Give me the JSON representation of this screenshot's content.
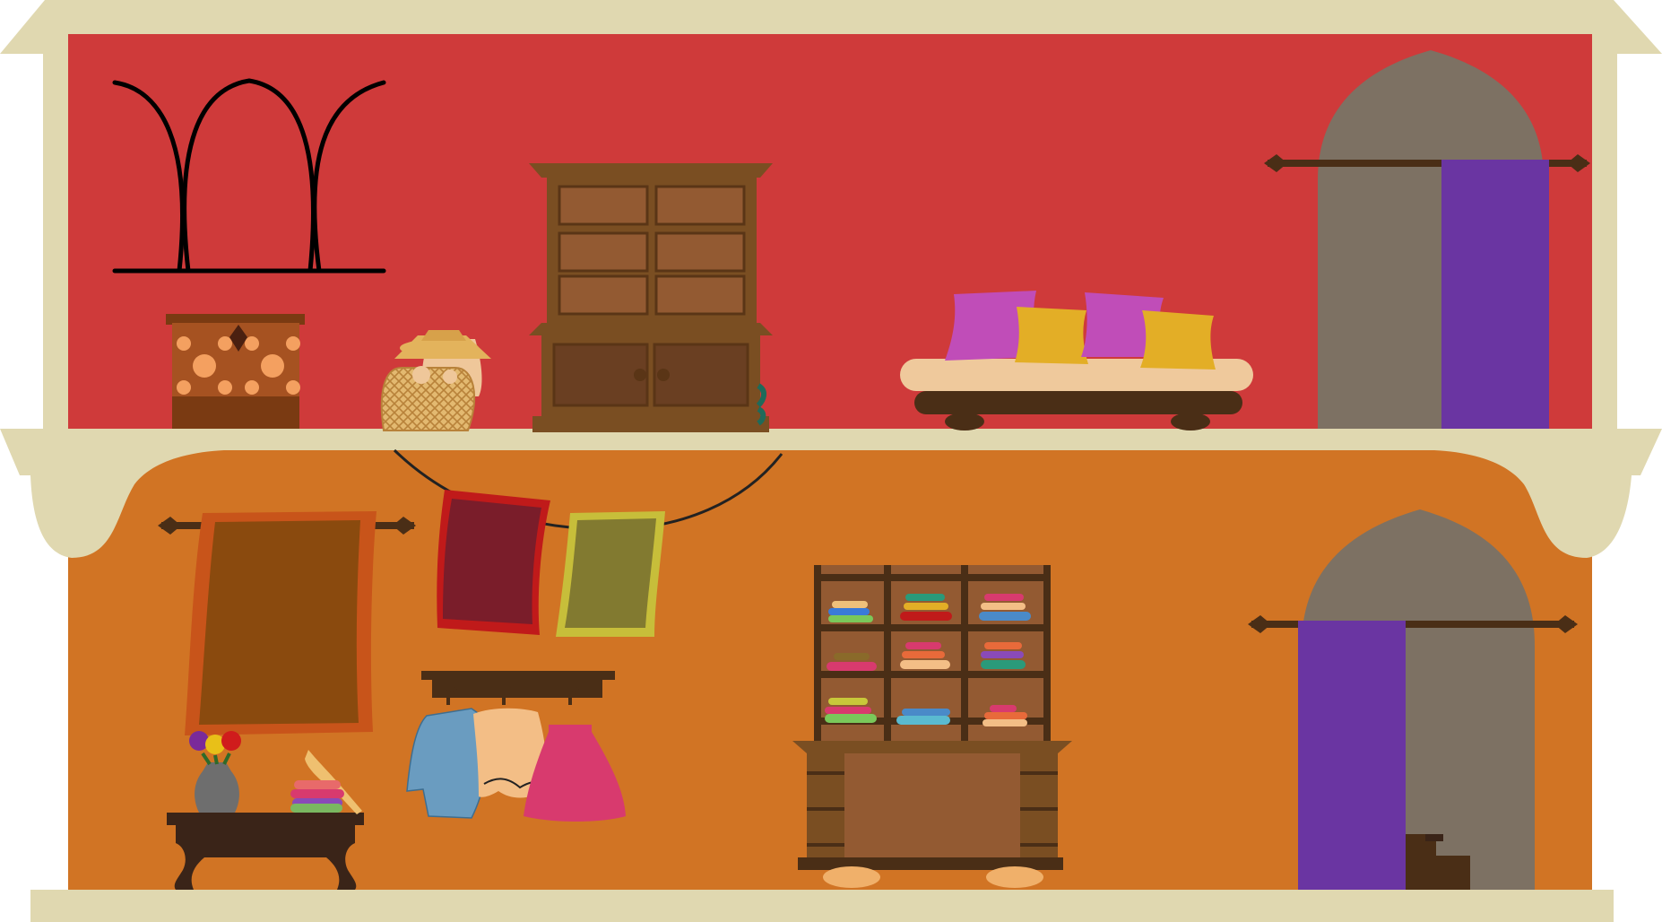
{
  "scene": {
    "kind": "two-storey house cross-section",
    "colors": {
      "upper_wall": "#CF3A3A",
      "lower_wall": "#D17424",
      "trim": "#E0D8B0",
      "wood_dark": "#4A2E16",
      "wood_mid": "#7A4E22",
      "wood_light": "#935A32",
      "curtain_purple": "#6A35A2",
      "archway_gray": "#7D7163",
      "rug_brown": "#8A4A0E",
      "towel_maroon": "#7A1D2A",
      "towel_olive": "#827A30",
      "cushion_pink": "#C04DB8",
      "cushion_gold": "#E3AE26",
      "skirt_pink": "#D83A6E",
      "shirt_blue": "#6A9CC0",
      "top_peach": "#F3BE86"
    },
    "upper_floor": {
      "items": [
        "arched-window",
        "jewelry-chest",
        "child-in-basket",
        "cupboard",
        "day-bed",
        "archway-with-curtain"
      ],
      "cushions": [
        "pink",
        "gold",
        "pink",
        "gold"
      ]
    },
    "lower_floor": {
      "items": [
        "hanging-rug",
        "washing-line",
        "towel-maroon",
        "towel-olive",
        "clothes-rack",
        "side-table",
        "flower-vase",
        "folded-clothes-stack",
        "shelving-unit",
        "archway-with-curtain",
        "stairs"
      ],
      "hanging_clothes": [
        "shirt-blue",
        "top-peach",
        "skirt-pink"
      ]
    }
  }
}
